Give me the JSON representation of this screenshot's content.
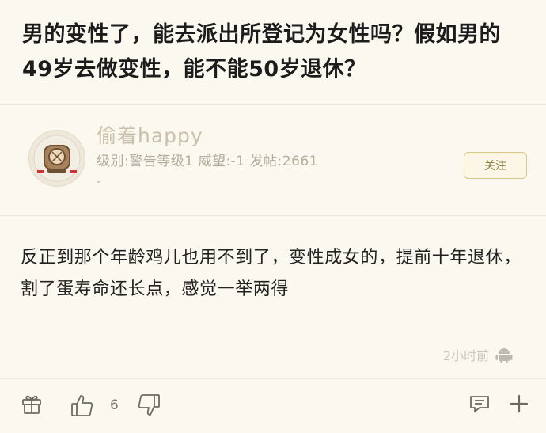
{
  "post": {
    "title": "男的变性了，能去派出所登记为女性吗？假如男的49岁去做变性，能不能50岁退休？"
  },
  "author": {
    "name": "偷着happy",
    "meta": "级别:警告等级1 威望:-1 发帖:2661",
    "meta_extra": "-",
    "follow_label": "关注"
  },
  "reply": {
    "text": "反正到那个年龄鸡儿也用不到了，变性成女的，提前十年退休，割了蛋寿命还长点，感觉一举两得",
    "time": "2小时前",
    "like_count": "6"
  },
  "icons": {
    "avatar": "diving-helmet-avatar",
    "device": "android-icon",
    "gift": "gift-icon",
    "like": "thumbs-up-icon",
    "dislike": "thumbs-down-icon",
    "comment": "comment-icon",
    "more": "plus-icon"
  },
  "colors": {
    "background": "#fbf8ef",
    "username": "#c8c1a9",
    "follow_border": "#d6c688"
  }
}
